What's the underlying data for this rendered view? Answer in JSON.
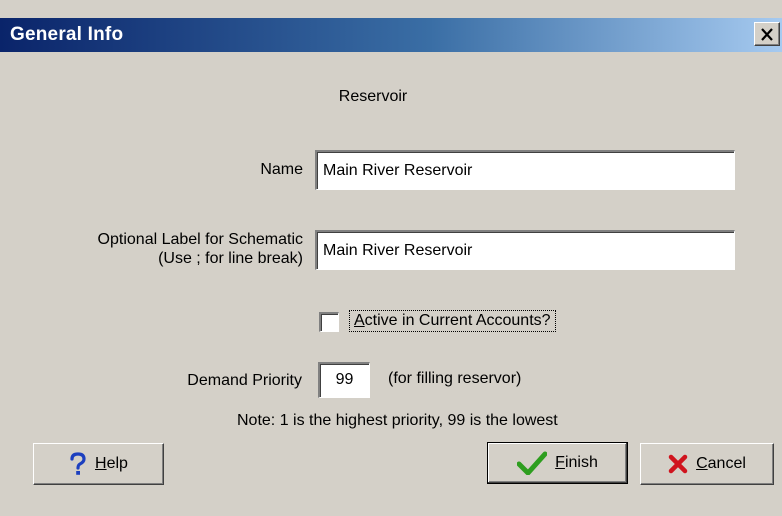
{
  "window": {
    "title": "General Info",
    "close_icon": "close-x-icon"
  },
  "form": {
    "heading": "Reservoir",
    "name_label": "Name",
    "name_value": "Main River Reservoir",
    "label_line1": "Optional Label for Schematic",
    "label_line2": "(Use ; for line break)",
    "label_value": "Main River Reservoir",
    "active_checked": false,
    "active_label_mnemonic": "A",
    "active_label_rest": "ctive in Current Accounts?",
    "priority_label": "Demand Priority",
    "priority_value": "99",
    "priority_hint": "(for filling reservor)",
    "note": "Note: 1 is the highest priority, 99 is the lowest"
  },
  "buttons": {
    "help": {
      "mnemonic": "H",
      "rest": "elp",
      "icon": "question-mark-icon",
      "icon_color": "#1c3fbf"
    },
    "finish": {
      "mnemonic": "F",
      "rest": "inish",
      "icon": "checkmark-icon",
      "icon_color": "#2e9e1f"
    },
    "cancel": {
      "mnemonic": "C",
      "rest": "ancel",
      "icon": "red-x-icon",
      "icon_color": "#d0141e"
    }
  },
  "colors": {
    "titlebar_start": "#0a246a",
    "titlebar_end": "#a6caf0",
    "dialog_bg": "#d4d0c8"
  }
}
